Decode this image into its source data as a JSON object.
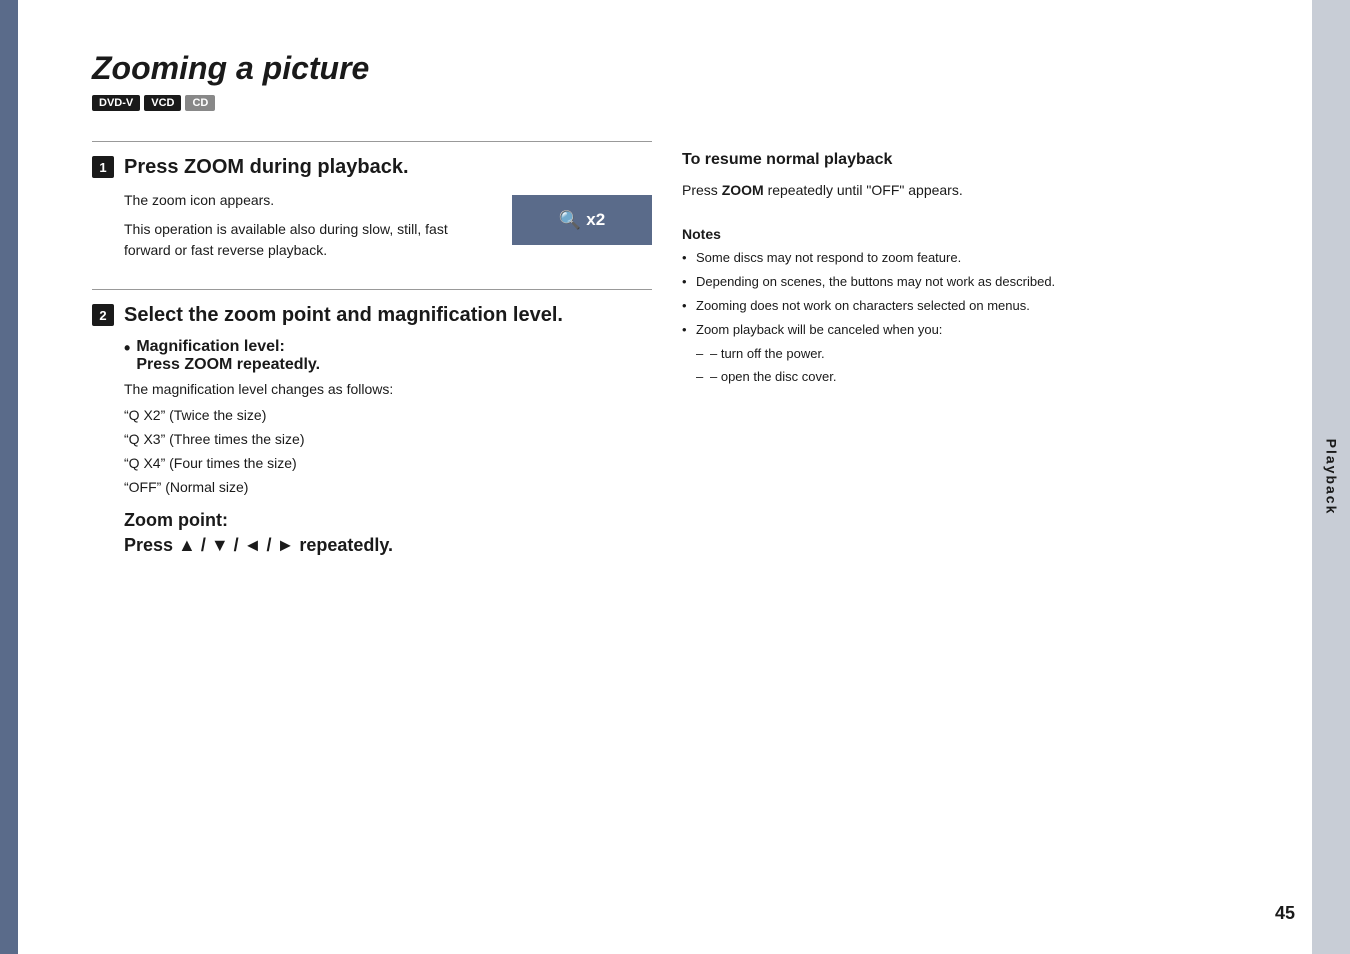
{
  "page": {
    "title": "Zooming a picture",
    "page_number": "45",
    "sidebar_label": "Playback"
  },
  "badges": [
    {
      "label": "DVD-V",
      "style": "dark"
    },
    {
      "label": "VCD",
      "style": "dark"
    },
    {
      "label": "CD",
      "style": "light"
    }
  ],
  "step1": {
    "number": "1",
    "title": "Press ZOOM during playback.",
    "description1": "The zoom icon appears.",
    "description2": "This operation is available also during slow, still, fast forward or fast reverse playback.",
    "zoom_display": "🔍 x2"
  },
  "step2": {
    "number": "2",
    "title": "Select the zoom point and magnification level.",
    "magnification_label": "Magnification level:",
    "magnification_desc": "Press ZOOM repeatedly.",
    "changes_desc": "The magnification level changes as follows:",
    "levels": [
      "“Q X2” (Twice the size)",
      "“Q X3” (Three times the size)",
      "“Q X4” (Four times the size)",
      "“OFF” (Normal size)"
    ],
    "zoom_point_label": "Zoom point:",
    "zoom_point_desc": "Press ▲ / ▼ / ◄ / ► repeatedly."
  },
  "right_col": {
    "resume_title": "To resume normal playback",
    "resume_desc": "Press ZOOM repeatedly until “OFF” appears.",
    "notes_title": "Notes",
    "notes": [
      "Some discs may not respond to zoom feature.",
      "Depending on scenes, the buttons may not work as described.",
      "Zooming does not work on characters selected on menus.",
      "Zoom playback will be canceled when you:"
    ],
    "sub_notes": [
      "– turn off the power.",
      "– open the disc cover."
    ]
  }
}
